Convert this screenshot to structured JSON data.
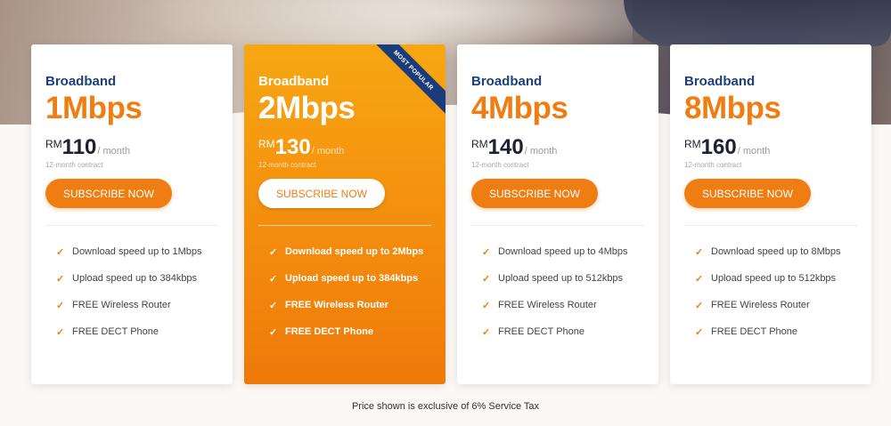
{
  "plans": [
    {
      "type": "Broadband",
      "speed": "1Mbps",
      "currency": "RM",
      "amount": "110",
      "period": "/ month",
      "contract": "12-month contract",
      "cta": "SUBSCRIBE NOW",
      "features": [
        "Download speed up to 1Mbps",
        "Upload speed up to 384kbps",
        "FREE Wireless Router",
        "FREE DECT Phone"
      ]
    },
    {
      "type": "Broadband",
      "speed": "2Mbps",
      "currency": "RM",
      "amount": "130",
      "period": "/ month",
      "contract": "12-month contract",
      "cta": "SUBSCRIBE NOW",
      "ribbon": "MOST POPULAR",
      "features": [
        "Download speed up to 2Mbps",
        "Upload speed up to 384kbps",
        "FREE Wireless Router",
        "FREE DECT Phone"
      ]
    },
    {
      "type": "Broadband",
      "speed": "4Mbps",
      "currency": "RM",
      "amount": "140",
      "period": "/ month",
      "contract": "12-month contract",
      "cta": "SUBSCRIBE NOW",
      "features": [
        "Download speed up to 4Mbps",
        "Upload speed up to 512kbps",
        "FREE Wireless Router",
        "FREE DECT Phone"
      ]
    },
    {
      "type": "Broadband",
      "speed": "8Mbps",
      "currency": "RM",
      "amount": "160",
      "period": "/ month",
      "contract": "12-month contract",
      "cta": "SUBSCRIBE NOW",
      "features": [
        "Download speed up to 8Mbps",
        "Upload speed up to 512kbps",
        "FREE Wireless Router",
        "FREE DECT Phone"
      ]
    }
  ],
  "footnote": "Price shown is exclusive of 6% Service Tax",
  "icons": {
    "feature": "check-icon"
  },
  "colors": {
    "accent": "#ef7d12",
    "brand": "#1d3f7a"
  }
}
